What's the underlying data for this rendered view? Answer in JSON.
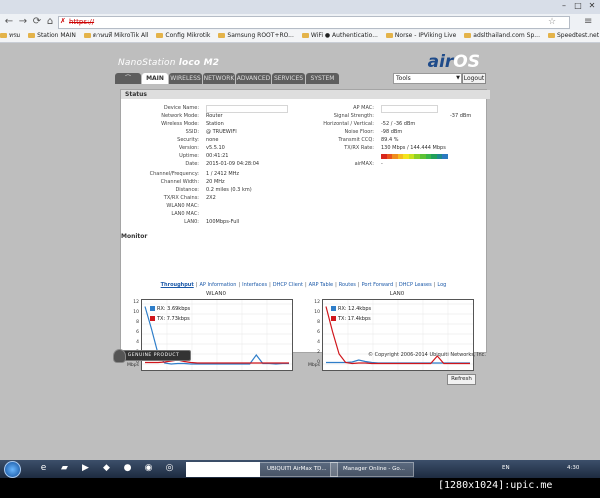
{
  "browser": {
    "tab_title": "",
    "address": "https://",
    "bookmarks": [
      "ทรม",
      "Station MAIN",
      "ดาษนที MikroTik All",
      "Config Mikrotik",
      "Samsung ROOT+RO...",
      "WiFi ● Authenticatio...",
      "Norse - IPViking Live",
      "adslthailand.com Sp...",
      "Speedtest.net by Oo..."
    ]
  },
  "airos": {
    "brand_name": "NanoStation",
    "brand_model": "loco M2",
    "logo_air": "air",
    "logo_os": "OS",
    "tabs": [
      "",
      "MAIN",
      "WIRELESS",
      "NETWORK",
      "ADVANCED",
      "SERVICES",
      "SYSTEM"
    ],
    "tools_label": "Tools",
    "logout_label": "Logout",
    "status_title": "Status",
    "left_fields": [
      {
        "label": "Device Name:",
        "value": ""
      },
      {
        "label": "Network Mode:",
        "value": "Router"
      },
      {
        "label": "Wireless Mode:",
        "value": "Station"
      },
      {
        "label": "SSID:",
        "value": "@ TRUEWIFI"
      },
      {
        "label": "Security:",
        "value": "none"
      },
      {
        "label": "Version:",
        "value": "v5.5.10"
      },
      {
        "label": "Uptime:",
        "value": "00:41:21"
      },
      {
        "label": "Date:",
        "value": "2015-01-09 04:28:04"
      }
    ],
    "left_fields2": [
      {
        "label": "Channel/Frequency:",
        "value": "1 / 2412 MHz"
      },
      {
        "label": "Channel Width:",
        "value": "20 MHz"
      },
      {
        "label": "Distance:",
        "value": "0.2 miles (0.3 km)"
      },
      {
        "label": "TX/RX Chains:",
        "value": "2X2"
      },
      {
        "label": "WLAN0 MAC:",
        "value": ""
      },
      {
        "label": "LAN0 MAC:",
        "value": ""
      },
      {
        "label": "LAN0:",
        "value": "100Mbps-Full"
      }
    ],
    "right_fields": [
      {
        "label": "AP MAC:",
        "value": ""
      },
      {
        "label": "Signal Strength:",
        "value": "-37 dBm"
      },
      {
        "label": "Horizontal / Vertical:",
        "value": "-52 / -36 dBm"
      },
      {
        "label": "Noise Floor:",
        "value": "-98 dBm"
      },
      {
        "label": "Transmit CCQ:",
        "value": "89.4 %"
      },
      {
        "label": "TX/RX Rate:",
        "value": "130 Mbps / 144.444 Mbps"
      },
      {
        "label": "",
        "value": ""
      },
      {
        "label": "airMAX:",
        "value": "-"
      }
    ],
    "signal_colors": [
      "#d9261c",
      "#e8541d",
      "#f08d1d",
      "#f5bd1f",
      "#f4e41d",
      "#c8e21e",
      "#8fd125",
      "#5cc234",
      "#39b54a",
      "#21a05a",
      "#1e8a8c",
      "#2b7ac0"
    ],
    "monitor_title": "Monitor",
    "monitor_links": [
      "Throughput",
      "AP Information",
      "Interfaces",
      "DHCP Client",
      "ARP Table",
      "Routes",
      "Port Forward",
      "DHCP Leases",
      "Log"
    ],
    "refresh_label": "Refresh",
    "genuine_label": "GENUINE PRODUCT",
    "copyright": "© Copyright 2006-2014 Ubiquiti Networks, Inc.",
    "rx_color": "#2f7ec9",
    "tx_color": "#d0161c"
  },
  "chart_data": [
    {
      "type": "line",
      "title": "WLAN0",
      "ylabel": "Mbps",
      "ylim": [
        0,
        12
      ],
      "yticks": [
        0,
        2,
        4,
        6,
        8,
        10,
        12
      ],
      "series": [
        {
          "name": "RX: 3.69kbps",
          "values": [
            11.5,
            7,
            2,
            0.2,
            0,
            0.1,
            0.1,
            0,
            0,
            0,
            0,
            0,
            0,
            0,
            0,
            0,
            0,
            1.8,
            0.1,
            0.1,
            0,
            0.1,
            0.1
          ]
        },
        {
          "name": "TX: 7.73kbps",
          "values": [
            0.3,
            0.3,
            0.3,
            0.4,
            0.6,
            0.8,
            0.5,
            0.3,
            0.2,
            0.2,
            0.2,
            0.2,
            0.2,
            0.2,
            0.2,
            0.2,
            0.2,
            0.2,
            0.2,
            0.2,
            0.2,
            0.2,
            0.2
          ]
        }
      ]
    },
    {
      "type": "line",
      "title": "LAN0",
      "ylabel": "Mbps",
      "ylim": [
        0,
        12
      ],
      "yticks": [
        0,
        2,
        4,
        6,
        8,
        10,
        12
      ],
      "series": [
        {
          "name": "RX: 12.4kbps",
          "values": [
            0.3,
            0.3,
            0.3,
            0.3,
            0.4,
            0.8,
            0.5,
            0.3,
            0.2,
            0.2,
            0.2,
            0.2,
            0.2,
            0.2,
            0.2,
            0.2,
            0.2,
            0.2,
            0.2,
            0.2,
            0.2,
            0.2,
            0.2
          ]
        },
        {
          "name": "TX: 17.4kbps",
          "values": [
            11.5,
            6.5,
            2,
            0.3,
            0.1,
            0.2,
            0.2,
            0.1,
            0.1,
            0.1,
            0.1,
            0.1,
            0.1,
            0.1,
            0.1,
            0.1,
            0.1,
            1.6,
            0.1,
            0.1,
            0.1,
            0.1,
            0.1
          ]
        }
      ]
    }
  ],
  "taskbar": {
    "tasks": [
      "",
      "UBIQUITI AirMax TD...",
      "Manager Online - Go..."
    ],
    "lang": "EN",
    "time": "4:30"
  },
  "watermark": "[1280x1024]:upic.me"
}
